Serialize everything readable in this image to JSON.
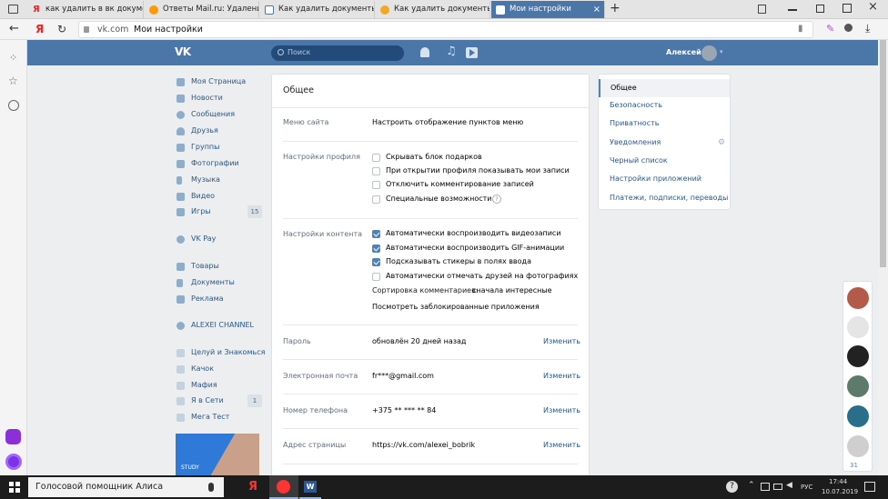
{
  "browser": {
    "tabs": [
      {
        "title": "как удалить в вк документ",
        "fav_color": "#e22"
      },
      {
        "title": "Ответы Mail.ru: Удаление",
        "fav_color": "#f90"
      },
      {
        "title": "Как удалить документы из",
        "fav_color": "#4a76a8"
      },
      {
        "title": "Как удалить документы из",
        "fav_color": "#f5a623"
      },
      {
        "title": "Мои настройки",
        "fav_color": "#fff"
      }
    ],
    "new_tab": "+",
    "close": "×",
    "domain": "vk.com",
    "page_title": "Мои настройки",
    "yandex_logo": "Я"
  },
  "vk": {
    "logo": "VK",
    "search_placeholder": "Поиск",
    "user_name": "Алексей",
    "nav": [
      {
        "label": "Моя Страница",
        "icon": "home-icon"
      },
      {
        "label": "Новости",
        "icon": "news-icon"
      },
      {
        "label": "Сообщения",
        "icon": "messages-icon"
      },
      {
        "label": "Друзья",
        "icon": "friends-icon"
      },
      {
        "label": "Группы",
        "icon": "groups-icon"
      },
      {
        "label": "Фотографии",
        "icon": "photos-icon"
      },
      {
        "label": "Музыка",
        "icon": "music-icon"
      },
      {
        "label": "Видео",
        "icon": "video-icon"
      },
      {
        "label": "Игры",
        "icon": "games-icon",
        "count": "15"
      },
      {
        "label": "VK Pay",
        "icon": "vkpay-icon"
      },
      {
        "label": "Товары",
        "icon": "goods-icon"
      },
      {
        "label": "Документы",
        "icon": "docs-icon"
      },
      {
        "label": "Реклама",
        "icon": "ads-icon"
      },
      {
        "label": "ALEXEI CHANNEL",
        "icon": "channel-icon"
      },
      {
        "label": "Целуй и Знакомься",
        "icon": "app-icon"
      },
      {
        "label": "Качок",
        "icon": "app-icon"
      },
      {
        "label": "Мафия",
        "icon": "app-icon"
      },
      {
        "label": "Я в Сети",
        "icon": "app-icon",
        "count": "1"
      },
      {
        "label": "Мега Тест",
        "icon": "app-icon"
      }
    ],
    "banner_text": "STUDY",
    "settings": {
      "title": "Общее",
      "site_menu_label": "Меню сайта",
      "site_menu_link": "Настроить отображение пунктов меню",
      "profile_label": "Настройки профиля",
      "profile_options": [
        {
          "label": "Скрывать блок подарков",
          "checked": false
        },
        {
          "label": "При открытии профиля показывать мои записи",
          "checked": false
        },
        {
          "label": "Отключить комментирование записей",
          "checked": false
        },
        {
          "label": "Специальные возможности",
          "checked": false
        }
      ],
      "help_mark": "?",
      "content_label": "Настройки контента",
      "content_options": [
        {
          "label": "Автоматически воспроизводить видеозаписи",
          "checked": true
        },
        {
          "label": "Автоматически воспроизводить GIF-анимации",
          "checked": true
        },
        {
          "label": "Подсказывать стикеры в полях ввода",
          "checked": true
        },
        {
          "label": "Автоматически отмечать друзей на фотографиях",
          "checked": false
        }
      ],
      "sort_label": "Сортировка комментариев:",
      "sort_value": "сначала интересные",
      "blocked_apps_link": "Посмотреть заблокированные приложения",
      "password_label": "Пароль",
      "password_value": "обновлён 20 дней назад",
      "email_label": "Электронная почта",
      "email_value": "fr***@gmail.com",
      "phone_label": "Номер телефона",
      "phone_value": "+375 ** *** ** 84",
      "address_label": "Адрес страницы",
      "address_value": "https://vk.com/alexei_bobrik",
      "change_label": "Изменить"
    },
    "right_menu": [
      "Общее",
      "Безопасность",
      "Приватность",
      "Уведомления",
      "Черный список",
      "Настройки приложений",
      "Платежи, подписки, переводы"
    ],
    "chat_counter": "31"
  },
  "taskbar": {
    "search_text": "Голосовой помощник Алиса",
    "lang": "РУС",
    "time": "17:44",
    "date": "10.07.2019"
  }
}
